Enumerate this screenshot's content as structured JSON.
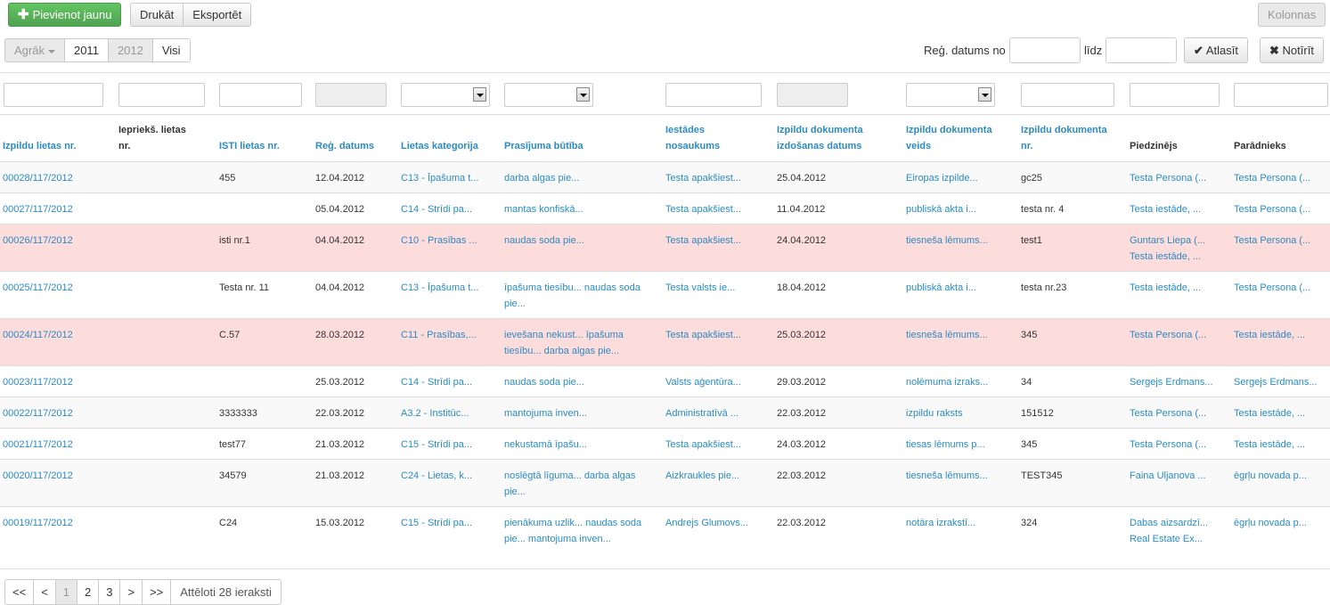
{
  "toolbar": {
    "add_new": "Pievienot jaunu",
    "print": "Drukāt",
    "export": "Eksportēt",
    "columns": "Kolonnas"
  },
  "years": {
    "earlier": "Agrāk",
    "y2011": "2011",
    "y2012": "2012",
    "all": "Visi"
  },
  "date_filter": {
    "from_label": "Reģ. datums no",
    "to_label": "līdz",
    "select": "Atlasīt",
    "clear": "Notīrīt"
  },
  "columns": [
    {
      "l1": "Izpildu lietas nr.",
      "l2": ""
    },
    {
      "l1": "Iepriekš. lietas",
      "l2": "nr."
    },
    {
      "l1": "ISTI lietas nr.",
      "l2": ""
    },
    {
      "l1": "Reģ. datums",
      "l2": ""
    },
    {
      "l1": "Lietas kategorija",
      "l2": ""
    },
    {
      "l1": "Prasījuma būtība",
      "l2": ""
    },
    {
      "l1": "Iestādes",
      "l2": "nosaukums"
    },
    {
      "l1": "Izpildu dokumenta",
      "l2": "izdošanas datums"
    },
    {
      "l1": "Izpildu dokumenta",
      "l2": "veids"
    },
    {
      "l1": "Izpildu dokumenta",
      "l2": "nr."
    },
    {
      "l1": "Piedzinējs",
      "l2": ""
    },
    {
      "l1": "Parādnieks",
      "l2": ""
    }
  ],
  "rows": [
    {
      "c0": "00028/117/2012",
      "c1": "",
      "c2": "455",
      "c3": "12.04.2012",
      "c4": "C13 - Īpašuma t...",
      "c5a": "darba algas pie...",
      "c5b": "",
      "c6": "Testa apakšiest...",
      "c7": "25.04.2012",
      "c8": "Eiropas izpilde...",
      "c9": "gc25",
      "c10a": "Testa Persona (...",
      "c10b": "",
      "c11": "Testa Persona (..."
    },
    {
      "c0": "00027/117/2012",
      "c1": "",
      "c2": "",
      "c3": "05.04.2012",
      "c4": "C14 - Strīdi pa...",
      "c5a": "mantas konfiskā...",
      "c5b": "",
      "c6": "Testa apakšiest...",
      "c7": "11.04.2012",
      "c8": "publiskā akta i...",
      "c9": "testa nr. 4",
      "c10a": "Testa iestāde, ...",
      "c10b": "",
      "c11": "Testa Persona (..."
    },
    {
      "c0": "00026/117/2012",
      "c1": "",
      "c2": "isti nr.1",
      "c3": "04.04.2012",
      "c4": "C10 - Prasības ...",
      "c5a": "naudas soda pie...",
      "c5b": "",
      "c6": "Testa apakšiest...",
      "c7": "24.04.2012",
      "c8": "tiesneša lēmums...",
      "c9": "test1",
      "c10a": "Guntars Liepa (...",
      "c10b": "Testa iestāde, ...",
      "c11": "Testa Persona (..."
    },
    {
      "c0": "00025/117/2012",
      "c1": "",
      "c2": "Testa nr. 11",
      "c3": "04.04.2012",
      "c4": "C13 - Īpašuma t...",
      "c5a": "īpašuma tiesību... naudas soda",
      "c5b": "pie...",
      "c6": "Testa valsts ie...",
      "c7": "18.04.2012",
      "c8": "publiskā akta i...",
      "c9": "testa nr.23",
      "c10a": "Testa iestāde, ...",
      "c10b": "",
      "c11": "Testa Persona (..."
    },
    {
      "c0": "00024/117/2012",
      "c1": "",
      "c2": "C.57",
      "c3": "28.03.2012",
      "c4": "C11 - Prasības,...",
      "c5a": "ievešana nekust... īpašuma",
      "c5b": "tiesību... darba algas pie...",
      "c6": "Testa apakšiest...",
      "c7": "25.03.2012",
      "c8": "tiesneša lēmums...",
      "c9": "345",
      "c10a": "Testa Persona (...",
      "c10b": "",
      "c11": "Testa iestāde, ..."
    },
    {
      "c0": "00023/117/2012",
      "c1": "",
      "c2": "",
      "c3": "25.03.2012",
      "c4": "C14 - Strīdi pa...",
      "c5a": "naudas soda pie...",
      "c5b": "",
      "c6": "Valsts aģentūra...",
      "c7": "29.03.2012",
      "c8": "nolēmuma izraks...",
      "c9": "34",
      "c10a": "Sergejs Erdmans...",
      "c10b": "",
      "c11": "Sergejs Erdmans..."
    },
    {
      "c0": "00022/117/2012",
      "c1": "",
      "c2": "3333333",
      "c3": "22.03.2012",
      "c4": "A3.2 - Institūc...",
      "c5a": "mantojuma inven...",
      "c5b": "",
      "c6": "Administratīvā ...",
      "c7": "22.03.2012",
      "c8": "izpildu raksts",
      "c9": "151512",
      "c10a": "Testa Persona (...",
      "c10b": "",
      "c11": "Testa iestāde, ..."
    },
    {
      "c0": "00021/117/2012",
      "c1": "",
      "c2": "test77",
      "c3": "21.03.2012",
      "c4": "C15 - Strīdi pa...",
      "c5a": "nekustamā īpašu...",
      "c5b": "",
      "c6": "Testa apakšiest...",
      "c7": "24.03.2012",
      "c8": "tiesas lēmums p...",
      "c9": "345",
      "c10a": "Testa Persona (...",
      "c10b": "",
      "c11": "Testa iestāde, ..."
    },
    {
      "c0": "00020/117/2012",
      "c1": "",
      "c2": "34579",
      "c3": "21.03.2012",
      "c4": "C24 - Lietas, k...",
      "c5a": "noslēgtā līguma... darba algas",
      "c5b": "pie...",
      "c6": "Aizkraukles pie...",
      "c7": "22.03.2012",
      "c8": "tiesneša lēmums...",
      "c9": "TEST345",
      "c10a": "Faina Uljanova ...",
      "c10b": "",
      "c11": "ēgrļu novada p..."
    },
    {
      "c0": "00019/117/2012",
      "c1": "",
      "c2": "C24",
      "c3": "15.03.2012",
      "c4": "C15 - Strīdi pa...",
      "c5a": "pienākuma uzlik... naudas soda",
      "c5b": "pie... mantojuma inven...",
      "c6": "Andrejs Glumovs...",
      "c7": "22.03.2012",
      "c8": "notāra izrakstī...",
      "c9": "324",
      "c10a": "Dabas aizsardzī...",
      "c10b": "Real Estate Ex...",
      "c11": "ēgrļu novada p..."
    }
  ],
  "pager": {
    "first": "<<",
    "prev": "<",
    "p1": "1",
    "p2": "2",
    "p3": "3",
    "next": ">",
    "last": ">>",
    "info": "Attēloti 28 ieraksti"
  }
}
